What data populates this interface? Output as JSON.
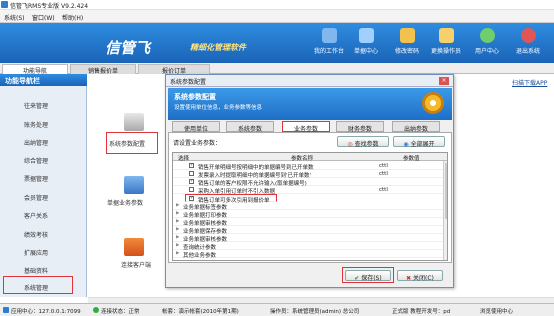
{
  "window": {
    "title": "信管飞RMS专业版 V9.2.424"
  },
  "menu": [
    "系统(S)",
    "窗口(W)",
    "帮助(H)"
  ],
  "header": {
    "logo": "信管飞",
    "slogan": "精细化管理软件",
    "buttons": [
      {
        "label": "我的工作台",
        "icon": "desktop-icon",
        "color": "#7fb7ee"
      },
      {
        "label": "单据中心",
        "icon": "document-icon",
        "color": "#7fb7ee"
      },
      {
        "label": "修改密码",
        "icon": "key-icon",
        "color": "#f2c14e"
      },
      {
        "label": "更换操作员",
        "icon": "user-switch-icon",
        "color": "#f2c14e"
      },
      {
        "label": "用户中心",
        "icon": "globe-icon",
        "color": "#6fcf6f"
      },
      {
        "label": "退出系统",
        "icon": "power-icon",
        "color": "#e05555"
      }
    ]
  },
  "tabs": [
    "功能导航",
    "销售报价单",
    "报价订单"
  ],
  "nav": {
    "title": "功能导航栏",
    "items": [
      "往来管理",
      "账务处理",
      "出纳管理",
      "综合管理",
      "票据管理",
      "会员管理",
      "客户关系",
      "绩效考核",
      "扩展应用",
      "基础资料",
      "系统管理"
    ]
  },
  "main": {
    "link": "扫描下载APP",
    "items": [
      {
        "label": "系统参数配置",
        "icon": "database-icon"
      },
      {
        "label": "单据业务参数",
        "icon": "document-settings-icon"
      },
      {
        "label": "连接客户端",
        "icon": "network-icon"
      }
    ]
  },
  "dialog": {
    "title": "系统参数配置",
    "close": "×",
    "head_title": "系统参数配置",
    "head_sub": "设置使用单位信息，业务参数等信息",
    "tabs": [
      "使用单位",
      "系统参数",
      "业务参数",
      "财务参数",
      "出纳参数"
    ],
    "prompt": "请设置业务参数：",
    "find_button": "查找参数",
    "expand_button": "全部展开",
    "columns": {
      "select": "选择",
      "name": "参数名称",
      "value": "参数值"
    },
    "rows": [
      {
        "type": "param",
        "checked": true,
        "name": "销售开单明细号按明细中的单据编号到已开单数",
        "value": "cttl"
      },
      {
        "type": "param",
        "checked": false,
        "name": "发票录入时提取明细中的单据编号到'已开单数'",
        "value": "cttl"
      },
      {
        "type": "param",
        "checked": true,
        "name": "销售订单的客户权限不允许输入(取单据编号)",
        "value": ""
      },
      {
        "type": "param",
        "checked": false,
        "name": "采购入单引用订单时不引入数据",
        "value": "cttl"
      },
      {
        "type": "param",
        "checked": true,
        "name": "销售订单可多次引用到报价单",
        "value": ""
      },
      {
        "type": "group",
        "name": "业务单据标签参数"
      },
      {
        "type": "group",
        "name": "业务单据打印参数"
      },
      {
        "type": "group",
        "name": "业务单据审核参数"
      },
      {
        "type": "group",
        "name": "业务单据保存参数"
      },
      {
        "type": "group",
        "name": "业务单据审核参数"
      },
      {
        "type": "group",
        "name": "查询统计参数"
      },
      {
        "type": "group",
        "name": "其他业务参数"
      }
    ],
    "save_button": "保存(S)",
    "close_button": "关闭(C)"
  },
  "status": {
    "ip": "应用中心：127.0.0.1:7099",
    "connect": "连接状态：正常",
    "account": "帐套：演示帐套(2010年第1期)",
    "operator": "操作员：系统管理员(admin) 总公司",
    "version": "正式版 教程开发号：pd",
    "help": "浏览使用中心"
  }
}
